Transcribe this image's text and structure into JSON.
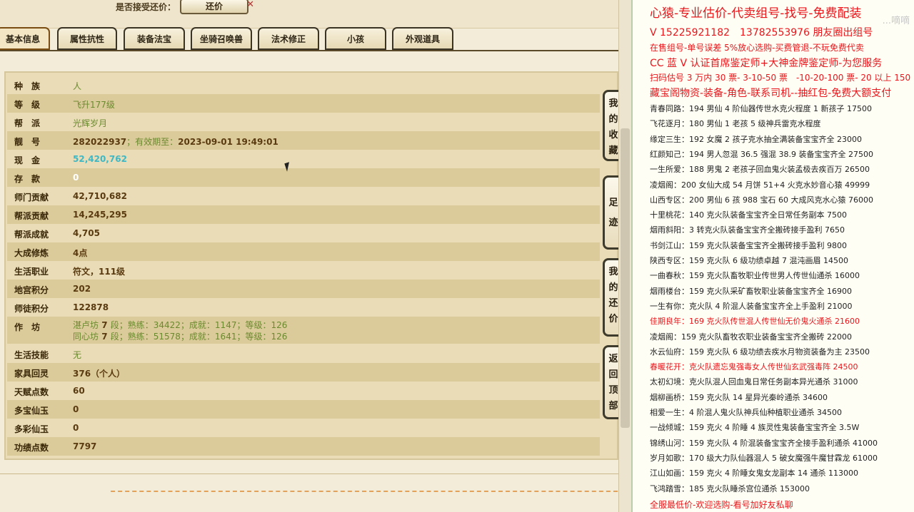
{
  "topbar": {
    "accept_label": "是否接受还价：",
    "counter_button": "还价"
  },
  "tabs": [
    {
      "label": "基本信息",
      "active": true
    },
    {
      "label": "属性抗性"
    },
    {
      "label": "装备法宝"
    },
    {
      "label": "坐骑召唤兽"
    },
    {
      "label": "法术修正"
    },
    {
      "label": "小孩"
    },
    {
      "label": "外观道具"
    }
  ],
  "info": {
    "race_label": "种　族",
    "race": "人",
    "level_label": "等　级",
    "level": "飞升177级",
    "guild_label": "帮　派",
    "guild": "光辉岁月",
    "id_label": "靓　号",
    "id": "282022937",
    "id_valid_prefix": "；有效期至：",
    "id_valid_date": "2023-09-01 19:49:01",
    "cash_label": "现　金",
    "cash": "52,420,762",
    "deposit_label": "存　款",
    "deposit": "0",
    "school_contrib_label": "师门贡献",
    "school_contrib": "42,710,682",
    "guild_contrib_label": "帮派贡献",
    "guild_contrib": "14,245,295",
    "guild_achieve_label": "帮派成就",
    "guild_achieve": "4,705",
    "dacheng_label": "大成修炼",
    "dacheng": "4点",
    "life_job_label": "生活职业",
    "life_job": "符文，111级",
    "palace_label": "地宫积分",
    "palace": "202",
    "mentor_label": "师徒积分",
    "mentor": "122878",
    "workshop_label": "作　坊",
    "workshop1_name": "湛卢坊",
    "workshop1_level": "7",
    "workshop1_rest": "段；熟练：34422；成就：1147；等级：126",
    "workshop2_name": "同心坊",
    "workshop2_level": "7",
    "workshop2_rest": "段；熟练：51578；成就：1641；等级：126",
    "life_skill_label": "生活技能",
    "life_skill": "无",
    "furniture_label": "家具回灵",
    "furniture": "376（个人）",
    "talent_label": "天赋点数",
    "talent": "60",
    "duobao_label": "多宝仙玉",
    "duobao": "0",
    "duocai_label": "多彩仙玉",
    "duocai": "0",
    "merit_label": "功绩点数",
    "merit": "7797"
  },
  "side_buttons": {
    "favorites": "我的收藏",
    "footprint": "足迹",
    "my_offers": "我的还价",
    "back_top": "返回顶部"
  },
  "ad": {
    "watermark": "...嘀嘀",
    "header1": "心猿-专业估价-代卖组号-找号-免费配装",
    "header2": "V 15225921182　13782553976 朋友圈出组号",
    "header3": "在售组号-单号误差 5%放心选购-买费管退-不玩免费代卖",
    "header4": "CC 蓝 V 认证首席鉴定师+大神金牌鉴定师-为您服务",
    "header5": "扫码估号 3 万内 30 票- 3-10-50 票　-10-20-100 票- 20 以上 150",
    "header6": "藏宝阁物资-装备-角色-联系司机--抽红包-免费大额支付",
    "listings": [
      {
        "name": "青春同路：",
        "text": "194 男仙 4 阶仙器传世水克火程度 1 新孩子 17500"
      },
      {
        "name": "飞花逐月：",
        "text": "180 男仙 1 老孩 5 级神兵雷克水程度"
      },
      {
        "name": "缘定三生：",
        "text": "192 女魔 2 孩子克水抽全满装备宝宝齐全 23000"
      },
      {
        "name": "红颜知己：",
        "text": "194 男人忽混 36.5 强混 38.9 装备宝宝齐全 27500"
      },
      {
        "name": "一生所爱：",
        "text": "188 男鬼 2 老孩子回血鬼火装孟极去疾百万 26500"
      },
      {
        "name": "凌烟阁：",
        "text": "200 女仙大成 54 月饼 51+4 火克水妙音心猿 49999"
      },
      {
        "name": "山西专区：",
        "text": "200 男仙 6 孩 988 宝石 60 大成风克水心猿 76000"
      },
      {
        "name": "十里桃花：",
        "text": "140 克火队装备宝宝齐全日常任务副本 7500"
      },
      {
        "name": "烟雨斜阳：",
        "text": "3 转克火队装备宝宝齐全搬砖接手盈利 7650"
      },
      {
        "name": "书剑江山：",
        "text": "159 克火队装备宝宝齐全搬砖接手盈利 9800"
      },
      {
        "name": "陕西专区：",
        "text": "159 克火队 6 级功绩卓越 7 混沌画眉 14500"
      },
      {
        "name": "一曲春秋：",
        "text": "159 克火队畜牧职业传世男人传世仙通杀 16000"
      },
      {
        "name": "烟雨楼台：",
        "text": "159 克火队采矿畜牧职业装备宝宝齐全 16900"
      },
      {
        "name": "一生有你：",
        "text": "克火队 4 阶混人装备宝宝齐全上手盈利 21000"
      },
      {
        "name": "佳期良年：",
        "text": "169 克火队传世混人传世仙无价鬼火通杀 21600",
        "red": true
      },
      {
        "name": "凌烟阁：",
        "text": "159 克火队畜牧农职业装备宝宝齐全搬砖 22000"
      },
      {
        "name": "水云仙府：",
        "text": "159 克火队 6 级功绩去疾水月物资装备为主 23500"
      },
      {
        "name": "春暖花开：",
        "text": "克火队遗忘鬼强毒女人传世仙玄武强毒阵 24500",
        "red": true
      },
      {
        "name": "太初幻境：",
        "text": "克火队混人回血鬼日常任务副本异光通杀 31000"
      },
      {
        "name": "烟柳画桥：",
        "text": "159 克火队 14 星异光秦岭通杀 34600"
      },
      {
        "name": "相爱一生：",
        "text": "4 阶混人鬼火队神兵仙种植职业通杀 34500"
      },
      {
        "name": "一战倾城：",
        "text": "159 克火 4 阶睡 4 族灵性鬼装备宝宝齐全 3.5W"
      },
      {
        "name": "锦绣山河：",
        "text": "159 克火队 4 阶混装备宝宝齐全接手盈利通杀 41000"
      },
      {
        "name": "岁月如歌：",
        "text": "170 级大力队仙器混人 5 破女魔强牛魔甘霖龙 61000"
      },
      {
        "name": "江山如画：",
        "text": "159 克火 4 阶睡女鬼女龙副本 14 通杀 113000"
      },
      {
        "name": "飞鸿踏雪：",
        "text": "185 克火队睡杀宫位通杀 153000"
      }
    ],
    "footer": "全服最低价-欢迎选购-看号加好友私聊"
  }
}
